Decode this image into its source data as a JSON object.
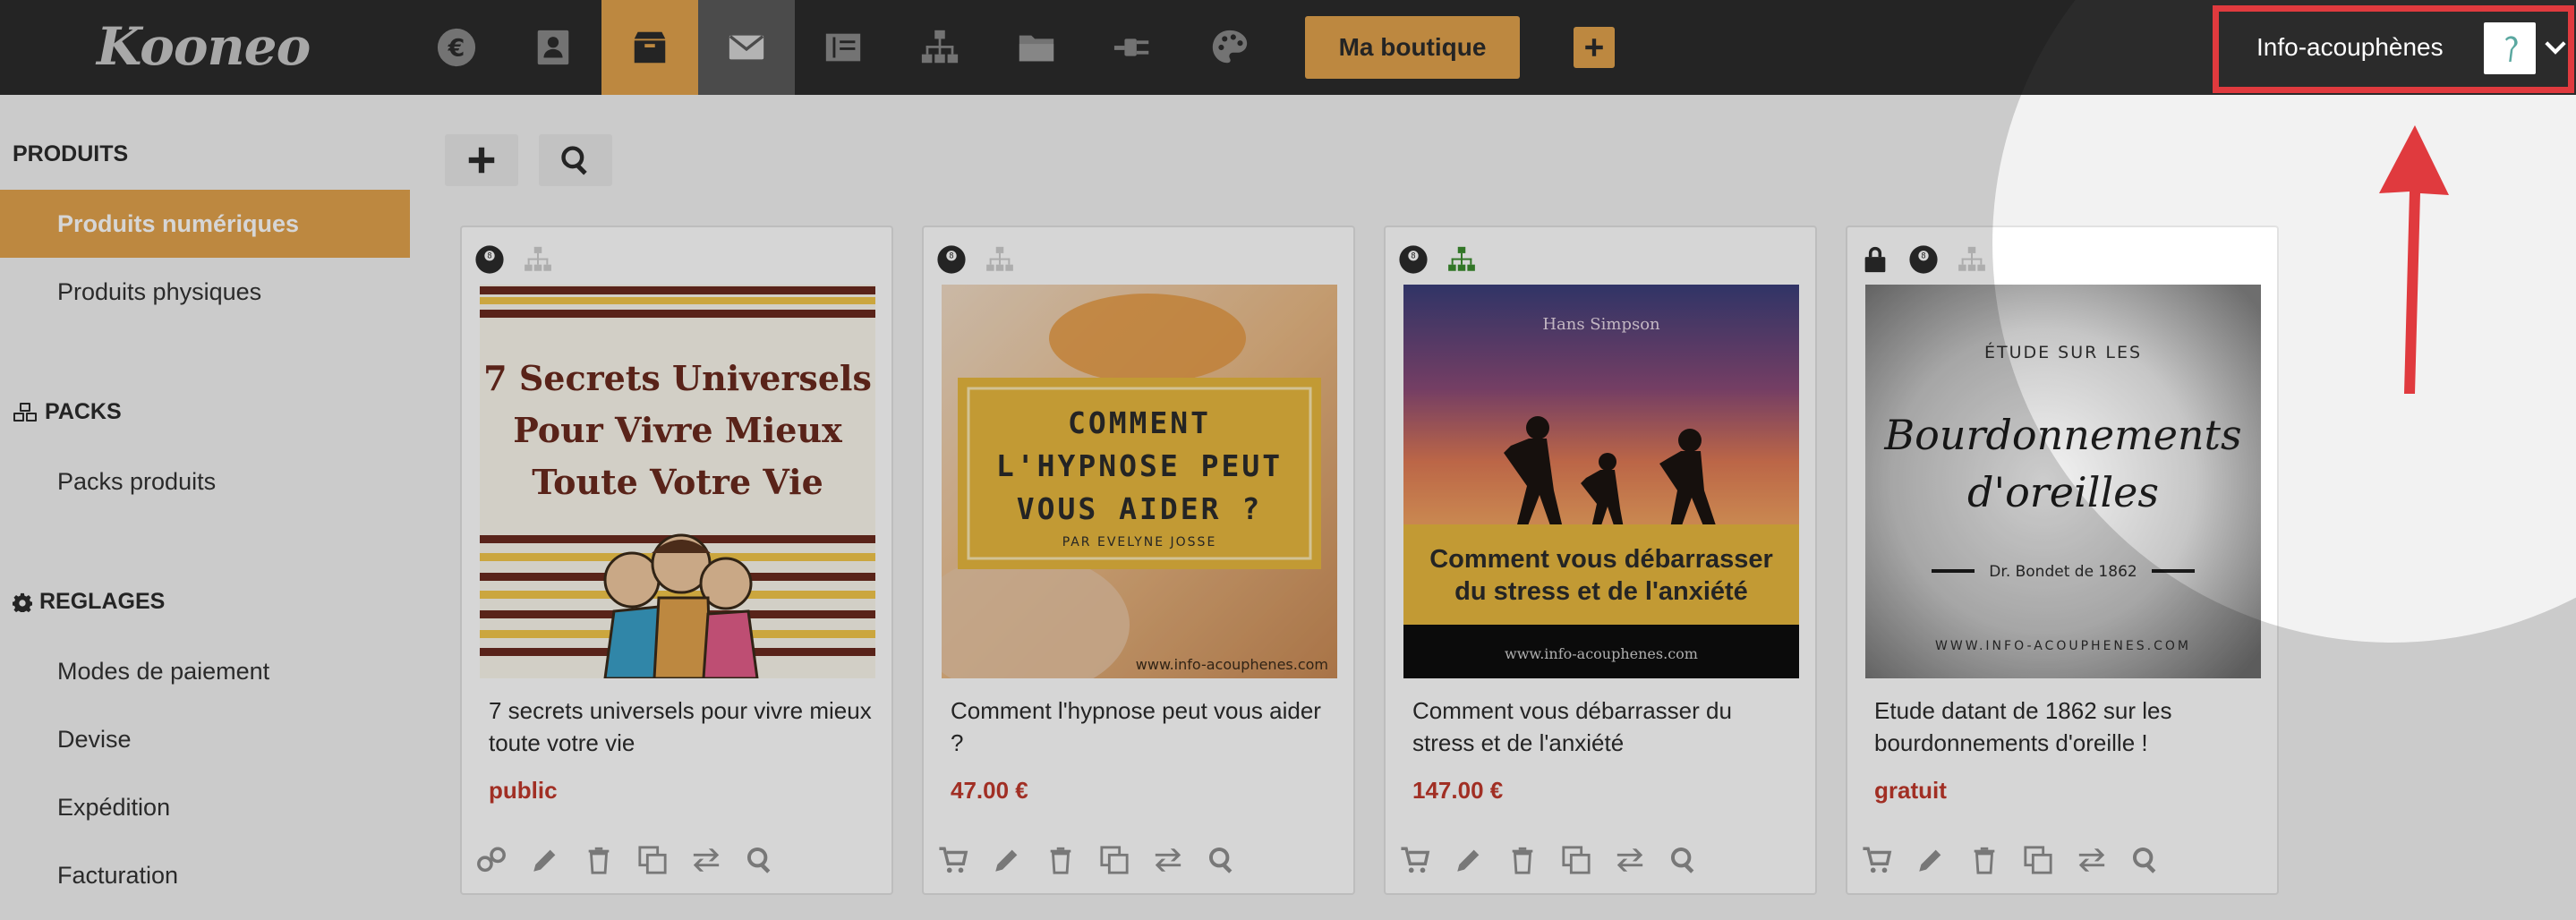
{
  "app": {
    "logo": "Kooneo"
  },
  "topbar": {
    "nav_icons": [
      "euro-icon",
      "contacts-icon",
      "box-icon",
      "mail-icon",
      "book-icon",
      "sitemap-icon",
      "folder-icon",
      "plug-icon",
      "palette-icon"
    ],
    "shop_button": "Ma boutique",
    "add_icon": "plus-icon",
    "account": {
      "name": "Info-acouphènes"
    }
  },
  "sidebar": {
    "sections": [
      {
        "title": "PRODUITS",
        "icon": "",
        "items": [
          "Produits numériques",
          "Produits physiques"
        ]
      },
      {
        "title": "PACKS",
        "icon": "cubes-icon",
        "items": [
          "Packs produits"
        ]
      },
      {
        "title": "REGLAGES",
        "icon": "gear-icon",
        "items": [
          "Modes de paiement",
          "Devise",
          "Expédition",
          "Facturation"
        ]
      }
    ],
    "active_item": "Produits numériques"
  },
  "toolbar": {
    "add_icon": "plus-icon",
    "search_icon": "search-icon"
  },
  "products": [
    {
      "title": "7 secrets universels pour vivre mieux toute votre vie",
      "price": "public",
      "image_text": [
        "7 Secrets Universels",
        "Pour Vivre Mieux",
        "Toute Votre Vie"
      ]
    },
    {
      "title": "Comment l'hypnose peut vous aider ?",
      "price": "47.00 €",
      "image_text": [
        "COMMENT",
        "L'HYPNOSE PEUT",
        "VOUS AIDER ?",
        "PAR EVELYNE JOSSE",
        "www.info-acouphenes.com"
      ]
    },
    {
      "title": "Comment vous débarrasser du stress et de l'anxiété",
      "price": "147.00 €",
      "image_text": [
        "Hans Simpson",
        "Comment vous débarrasser",
        "du stress et de l'anxiété",
        "www.info-acouphenes.com"
      ]
    },
    {
      "title": "Etude datant de 1862 sur les bourdonnements d'oreille !",
      "price": "gratuit",
      "image_text": [
        "ÉTUDE SUR LES",
        "Bourdonnements",
        "d'oreilles",
        "Dr. Bondet de 1862",
        "WWW.INFO-ACOUPHENES.COM"
      ]
    }
  ],
  "colors": {
    "accent": "#e2a24d",
    "topbar": "#2b2b2b",
    "price": "#c0392b",
    "highlight": "#e03a3e"
  }
}
